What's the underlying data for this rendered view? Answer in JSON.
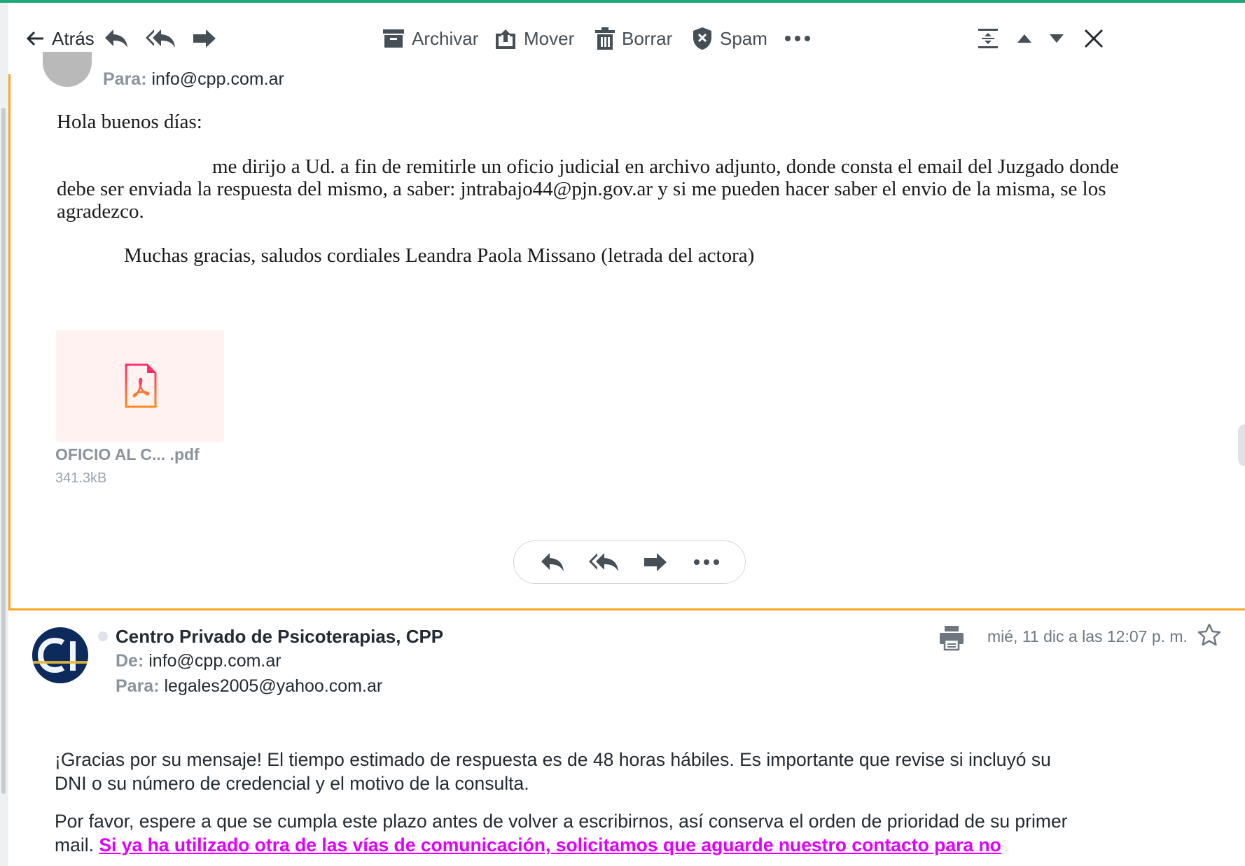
{
  "toolbar": {
    "back_label": "Atrás",
    "archive_label": "Archivar",
    "move_label": "Mover",
    "delete_label": "Borrar",
    "spam_label": "Spam"
  },
  "message1": {
    "to_label": "Para:",
    "to_value": "info@cpp.com.ar",
    "greeting": "Hola buenos días:",
    "paragraph_line1": "me dirijo a Ud. a fin de remitirle un oficio judicial en archivo adjunto, donde consta el email del Juzgado donde",
    "paragraph_line2": "debe ser enviada la respuesta del mismo, a saber: jntrabajo44@pjn.gov.ar y si me pueden hacer saber el envio de la misma, se los",
    "paragraph_line3": "agradezco.",
    "signature": "Muchas gracias, saludos cordiales Leandra Paola Missano (letrada del actora)",
    "attachment": {
      "name": "OFICIO AL C... .pdf",
      "size": "341.3kB"
    }
  },
  "message2": {
    "sender": "Centro Privado de Psicoterapias, CPP",
    "from_label": "De:",
    "from_value": "info@cpp.com.ar",
    "to_label": "Para:",
    "to_value": "legales2005@yahoo.com.ar",
    "datetime": "mié, 11 dic a las 12:07 p. m.",
    "body_p1_line1": "¡Gracias por su mensaje! El tiempo estimado de respuesta es de 48 horas hábiles. Es importante que revise si incluyó su",
    "body_p1_line2": "DNI o su número de credencial y el motivo de la consulta.",
    "body_p2_line1": "Por favor, espere a que se cumpla este plazo antes de volver a escribirnos, así conserva el orden de prioridad de su primer",
    "body_p2_line2_prefix": "mail.",
    "body_p2_link": "Si ya ha utilizado otra de las vías de comunicación, solicitamos que aguarde nuestro contacto para no"
  },
  "colors": {
    "selected_border": "#f7a823",
    "top_accent": "#1fa97a",
    "link": "#e100ff",
    "pdf_icon": "#ff2d6d"
  }
}
